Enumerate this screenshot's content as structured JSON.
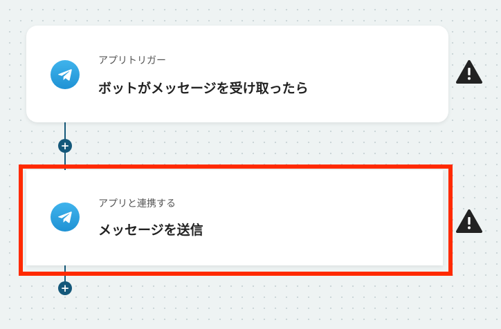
{
  "steps": [
    {
      "subtitle": "アプリトリガー",
      "title": "ボットがメッセージを受け取ったら",
      "app_icon": "telegram-icon"
    },
    {
      "subtitle": "アプリと連携する",
      "title": "メッセージを送信",
      "app_icon": "telegram-icon"
    }
  ],
  "add_button": {
    "symbol": "+"
  },
  "warning_icon": "warning-triangle-icon",
  "colors": {
    "connector": "#14587a",
    "highlight": "#ff2a00",
    "telegram": "#2aa3e0",
    "background": "#eef3f3"
  }
}
